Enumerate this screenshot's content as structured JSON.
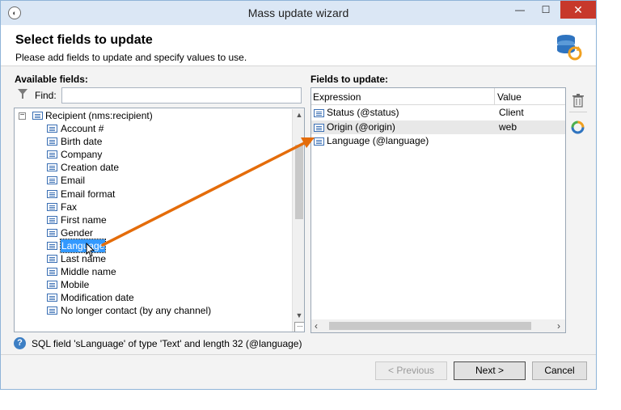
{
  "window": {
    "title": "Mass update wizard",
    "minimize": "—",
    "maximize": "☐",
    "close": "✕"
  },
  "header": {
    "title": "Select fields to update",
    "subtitle": "Please add fields to update and specify values to use."
  },
  "available": {
    "label": "Available fields:",
    "find_label": "Find:",
    "find_value": "",
    "root": "Recipient (nms:recipient)",
    "items": [
      "Account #",
      "Birth date",
      "Company",
      "Creation date",
      "Email",
      "Email format",
      "Fax",
      "First name",
      "Gender",
      "Language",
      "Last name",
      "Middle name",
      "Mobile",
      "Modification date",
      "No longer contact (by any channel)"
    ],
    "selected_index": 9
  },
  "to_update": {
    "label": "Fields to update:",
    "col_expression": "Expression",
    "col_value": "Value",
    "rows": [
      {
        "expression": "Status (@status)",
        "value": "Client"
      },
      {
        "expression": "Origin (@origin)",
        "value": "web"
      },
      {
        "expression": "Language (@language)",
        "value": ""
      }
    ],
    "selected_row": 1
  },
  "status": {
    "text": "SQL field 'sLanguage' of type 'Text' and length 32 (@language)"
  },
  "buttons": {
    "previous": "< Previous",
    "next": "Next >",
    "cancel": "Cancel"
  },
  "colors": {
    "accent": "#3399ff",
    "arrow": "#e46c0a",
    "close": "#c7382b"
  },
  "icons": [
    "filter-icon",
    "database-sync-icon",
    "field-icon",
    "trash-icon",
    "refresh-icon",
    "help-icon",
    "cursor-icon"
  ]
}
